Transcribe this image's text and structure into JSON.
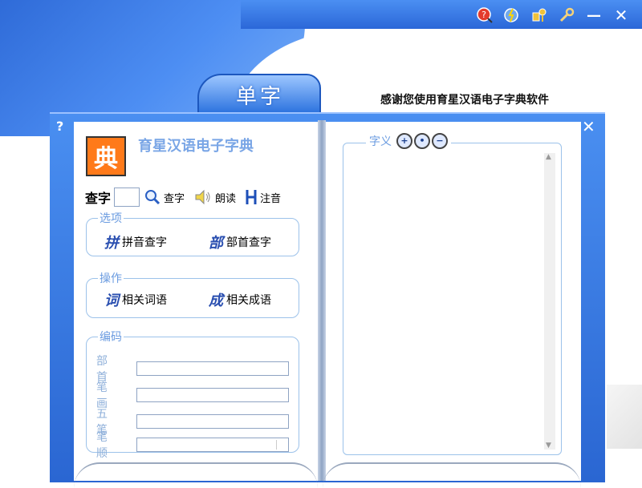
{
  "window": {
    "tab_label": "单字",
    "thanks_message": "感谢您使用育星汉语电子字典软件",
    "help_symbol": "?",
    "close_symbol": "✕"
  },
  "toolbar": {
    "icons": [
      "help-icon",
      "update-icon",
      "keys-icon",
      "settings-icon",
      "minimize-icon",
      "close-icon"
    ],
    "minimize_symbol": "—",
    "close_symbol": "✕"
  },
  "left_page": {
    "logo_glyph": "典",
    "app_title": "育星汉语电子字典",
    "query": {
      "label": "查字",
      "input_value": "",
      "search_label": "查字",
      "read_label": "朗读",
      "phonetic_label": "注音"
    },
    "options": {
      "legend": "选项",
      "pinyin_glyph": "拼",
      "pinyin_label": "拼音查字",
      "radical_glyph": "部",
      "radical_label": "部首查字"
    },
    "operations": {
      "legend": "操作",
      "words_glyph": "词",
      "words_label": "相关词语",
      "idioms_glyph": "成",
      "idioms_label": "相关成语"
    },
    "encoding": {
      "legend": "编码",
      "fields": [
        {
          "label": "部首",
          "value": ""
        },
        {
          "label": "笔画",
          "value": ""
        },
        {
          "label": "五笔",
          "value": ""
        },
        {
          "label": "笔顺",
          "value": ""
        }
      ]
    }
  },
  "right_page": {
    "meaning_legend": "字义",
    "zoom_in": "+",
    "zoom_reset": "•",
    "zoom_out": "−",
    "content": ""
  },
  "colors": {
    "accent_blue": "#2e74df",
    "legend_blue": "#6a9be0",
    "logo_orange": "#ff7a1a"
  }
}
